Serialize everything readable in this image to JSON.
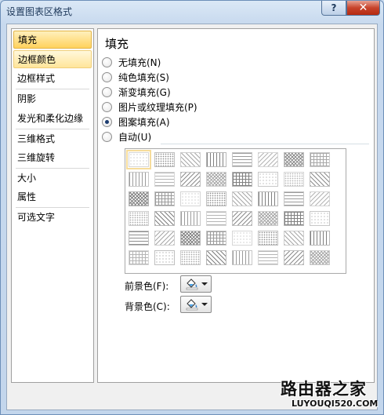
{
  "window": {
    "title": "设置图表区格式",
    "help_label": "?",
    "close_label": "✕"
  },
  "nav": {
    "items": [
      {
        "label": "填充",
        "state": "selected"
      },
      {
        "label": "边框颜色",
        "state": "hover"
      },
      {
        "label": "边框样式",
        "state": "normal"
      },
      {
        "label": "阴影",
        "state": "normal"
      },
      {
        "label": "发光和柔化边缘",
        "state": "normal"
      },
      {
        "label": "三维格式",
        "state": "normal"
      },
      {
        "label": "三维旋转",
        "state": "normal"
      },
      {
        "label": "大小",
        "state": "normal"
      },
      {
        "label": "属性",
        "state": "normal"
      },
      {
        "label": "可选文字",
        "state": "normal"
      }
    ]
  },
  "fill": {
    "title": "填充",
    "options": [
      {
        "label": "无填充(N)",
        "checked": false
      },
      {
        "label": "纯色填充(S)",
        "checked": false
      },
      {
        "label": "渐变填充(G)",
        "checked": false
      },
      {
        "label": "图片或纹理填充(P)",
        "checked": false
      },
      {
        "label": "图案填充(A)",
        "checked": true
      },
      {
        "label": "自动(U)",
        "checked": false
      }
    ],
    "foreground_label": "前景色(F):",
    "background_label": "背景色(C):",
    "color_icon": "paint-bucket-icon"
  },
  "pattern_grid": {
    "rows": 6,
    "cols": 8,
    "selected_index": 0,
    "fg_color": "#7a7a7a",
    "bg_color": "#ffffff"
  },
  "watermark": {
    "text": "路由器之家",
    "url": "LUYOUQI520.COM"
  }
}
